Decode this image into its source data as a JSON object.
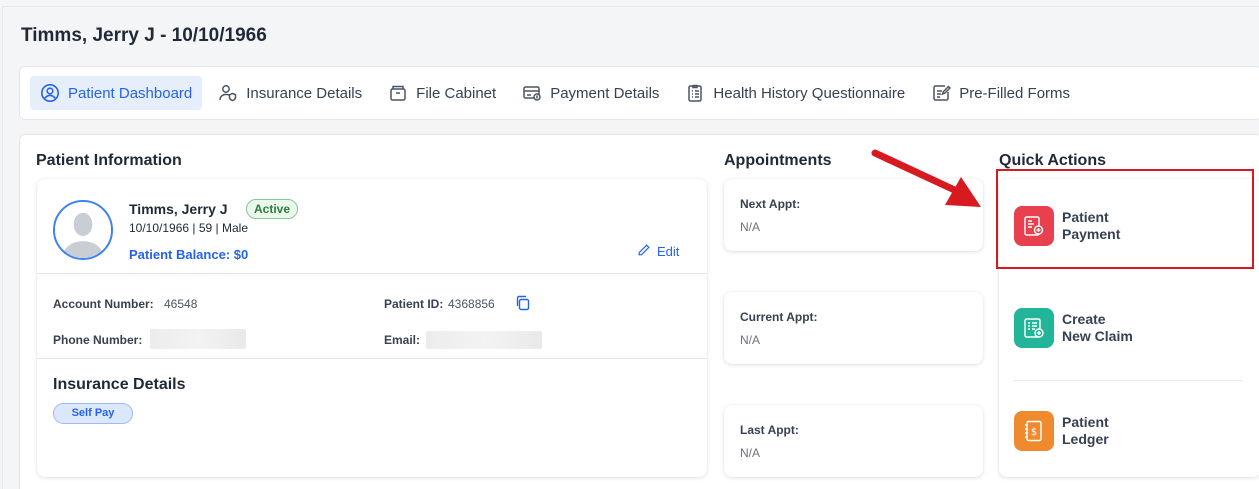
{
  "page": {
    "title": "Timms, Jerry J - 10/10/1966"
  },
  "tabs": [
    {
      "label": "Patient Dashboard",
      "icon": "user-circle-icon",
      "active": true
    },
    {
      "label": "Insurance Details",
      "icon": "users-shield-icon",
      "active": false
    },
    {
      "label": "File Cabinet",
      "icon": "cabinet-icon",
      "active": false
    },
    {
      "label": "Payment Details",
      "icon": "payment-card-icon",
      "active": false
    },
    {
      "label": "Health History Questionnaire",
      "icon": "clipboard-list-icon",
      "active": false
    },
    {
      "label": "Pre-Filled Forms",
      "icon": "form-edit-icon",
      "active": false
    }
  ],
  "patient_info": {
    "section_title": "Patient Information",
    "name": "Timms, Jerry J",
    "status": "Active",
    "dob": "10/10/1966",
    "age": "59",
    "sex": "Male",
    "demographics": "10/10/1966 | 59 | Male",
    "balance": "Patient Balance: $0",
    "edit_label": "Edit",
    "account_label": "Account Number:",
    "account_number": "46548",
    "patient_id_label": "Patient ID:",
    "patient_id": "4368856",
    "phone_label": "Phone Number:",
    "email_label": "Email:",
    "insurance_title": "Insurance Details",
    "insurance_badge": "Self Pay"
  },
  "appointments": {
    "section_title": "Appointments",
    "next_label": "Next Appt:",
    "next_value": "N/A",
    "current_label": "Current Appt:",
    "current_value": "N/A",
    "last_label": "Last Appt:",
    "last_value": "N/A"
  },
  "quick_actions": {
    "section_title": "Quick Actions",
    "items": [
      {
        "line1": "Patient",
        "line2": "Payment",
        "color": "#e8404f",
        "icon": "payment-receipt-icon"
      },
      {
        "line1": "Create",
        "line2": "New Claim",
        "color": "#22b59a",
        "icon": "new-claim-icon"
      },
      {
        "line1": "Patient",
        "line2": "Ledger",
        "color": "#ef8a2e",
        "icon": "ledger-icon"
      }
    ]
  },
  "colors": {
    "accent": "#2563eb",
    "highlight": "#d71920",
    "active_badge": "#2f7d3e"
  }
}
